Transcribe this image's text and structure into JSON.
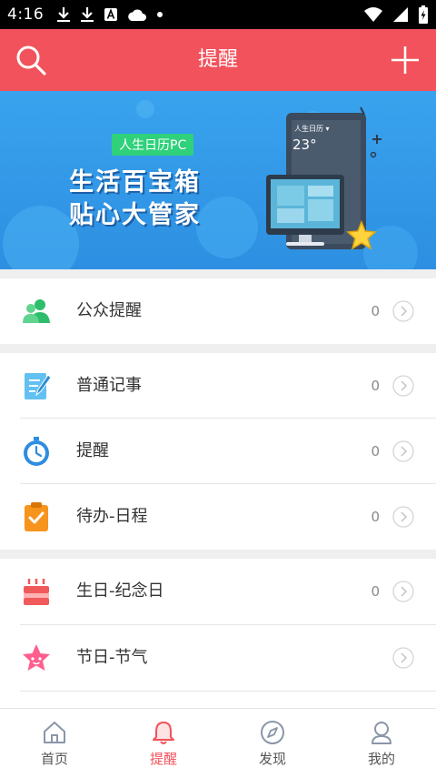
{
  "status_bar": {
    "time": "4:16"
  },
  "app_bar": {
    "title": "提醒"
  },
  "banner": {
    "tag": "人生日历PC",
    "line1": "生活百宝箱",
    "line2": "贴心大管家",
    "screen_title": "人生日历 ▾",
    "screen_temp": "23°"
  },
  "sections": [
    {
      "items": [
        {
          "label": "公众提醒",
          "count": "0",
          "icon": "people-icon"
        }
      ]
    },
    {
      "items": [
        {
          "label": "普通记事",
          "count": "0",
          "icon": "notepad-icon"
        },
        {
          "label": "提醒",
          "count": "0",
          "icon": "stopwatch-icon"
        },
        {
          "label": "待办-日程",
          "count": "0",
          "icon": "todo-clipboard-icon"
        }
      ]
    },
    {
      "items": [
        {
          "label": "生日-纪念日",
          "count": "0",
          "icon": "cake-icon"
        },
        {
          "label": "节日-节气",
          "count": "",
          "icon": "star-icon"
        }
      ]
    }
  ],
  "tabs": [
    {
      "label": "首页",
      "icon": "home-icon",
      "active": false
    },
    {
      "label": "提醒",
      "icon": "bell-icon",
      "active": true
    },
    {
      "label": "发现",
      "icon": "compass-icon",
      "active": false
    },
    {
      "label": "我的",
      "icon": "user-icon",
      "active": false
    }
  ],
  "colors": {
    "accent": "#f2525b",
    "banner": "#2d8fe1"
  }
}
